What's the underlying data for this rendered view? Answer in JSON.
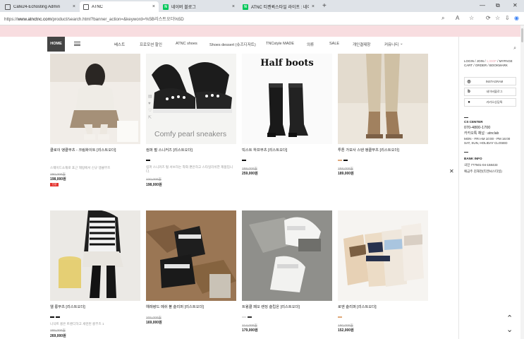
{
  "browser": {
    "tabs": [
      {
        "title": "Cafe24-Echosting Admin",
        "close": "×"
      },
      {
        "title": "ATNC",
        "close": "×"
      },
      {
        "title": "네이버 블로그",
        "close": "×"
      },
      {
        "title": "ATNC 티켄퀵스타일 라이프 : 네이",
        "close": "×"
      }
    ],
    "new_tab": "+",
    "url_prefix": "https://",
    "url_host": "www.atnctnc.com",
    "url_path": "/product/search.html?banner_action=&keyword=%5B리스트오더%5D",
    "window_controls": [
      "—",
      "⧉",
      "✕"
    ],
    "favicon_naver": "N",
    "addr_icons": [
      "⌕",
      "A",
      "☆",
      "⟳",
      "☆",
      "⇩",
      "◉"
    ]
  },
  "nav": {
    "home": "HOME",
    "items": [
      "베스트",
      "프로모션 할인",
      "ATNC shoes",
      "Shoes dessert (슈즈디저트)",
      "TNCstyle MADE",
      "의류",
      "SALE",
      "개인결제창",
      "커뮤니티",
      "⌄"
    ]
  },
  "products": [
    {
      "name": "클로이 앵클부츠 - 크림화이트 [리스트오더]",
      "desc": "스웨이드소재로 포근 헤링에서 신규 앵클부츠",
      "orig": "290,000원",
      "price": "198,000원",
      "badge": "신상",
      "swatches": []
    },
    {
      "name": "컴퍼 펄 스니커즈 [리스트오더]",
      "desc": "컴퍼 스니커즈 펄 서브하는 착화 편안하고 스타일리쉬한 제품입니다.",
      "orig": "220,000원",
      "price": "198,000원",
      "swatches": [
        "#111111"
      ],
      "overlay_text": "Comfy pearl sneakers",
      "overlay_icons": [
        "▤",
        "♥",
        "♡",
        "⇱"
      ]
    },
    {
      "name": "빅스트 하프부츠 [리스트오더]",
      "desc": "",
      "orig": "289,000원",
      "price": "259,000원",
      "swatches": [
        "#111111"
      ],
      "overlay_text": "Half boots"
    },
    {
      "name": "투톤 가보사 스텐 앵클부츠 [리스트오더]",
      "desc": "",
      "orig": "258,000원",
      "price": "189,000원",
      "swatches": [
        "#e0a97a",
        "#111111"
      ]
    },
    {
      "name": "웰 롱부츠 [리스트오더]",
      "desc": "니삭트 롱은 트렌디하고 세련된 롱부츠 1",
      "orig": "285,000원",
      "price": "269,000원",
      "swatches": [
        "#111111",
        "#111111"
      ]
    },
    {
      "name": "예래량드 메쉬 볼 슬리퍼 [리스트오더]",
      "desc": "",
      "orig": "205,000원",
      "price": "169,000원",
      "swatches": []
    },
    {
      "name": "트윙클 페오 랜징 슬립온 [리스트오더]",
      "desc": "",
      "orig": "214,000원",
      "price": "179,000원",
      "swatches": [
        "#dddddd",
        "#333333"
      ]
    },
    {
      "name": "로엔 슬리퍼 [리스트오더]",
      "desc": "",
      "orig": "190,000원",
      "price": "152,000원",
      "swatches": [
        "#e0a97a"
      ]
    }
  ],
  "sidebar": {
    "search_icon": "⌕",
    "links_line1": "LOGIN / JOIN / ",
    "links_hl": "1,000P",
    "links_line1_end": " / MYPAGE",
    "links_line2": "CART / ORDER / BOOKMARK",
    "social": [
      {
        "icon": "◎",
        "label": "INSTAGRAM"
      },
      {
        "icon": "b",
        "label": "네이버블로그"
      },
      {
        "icon": "●",
        "label": "카카오상담톡"
      }
    ],
    "cs_title": "CS CENTER",
    "cs_phone": "070-4800-1700",
    "cs_kakao": "카카오톡 채널 : atnclab",
    "cs_hours1": "MON - FRI   AM 10:00 - PM 16:00",
    "cs_hours2": "SAT, SUN, HOLIDAY CLOSED",
    "bank_title": "BANK INFO",
    "bank_line1": "국민   777501-04-158433",
    "bank_line2": "예금주   김재천(티엔씨스타일)"
  },
  "controls": {
    "close": "✕",
    "up": "⌃",
    "down": "⌄"
  }
}
